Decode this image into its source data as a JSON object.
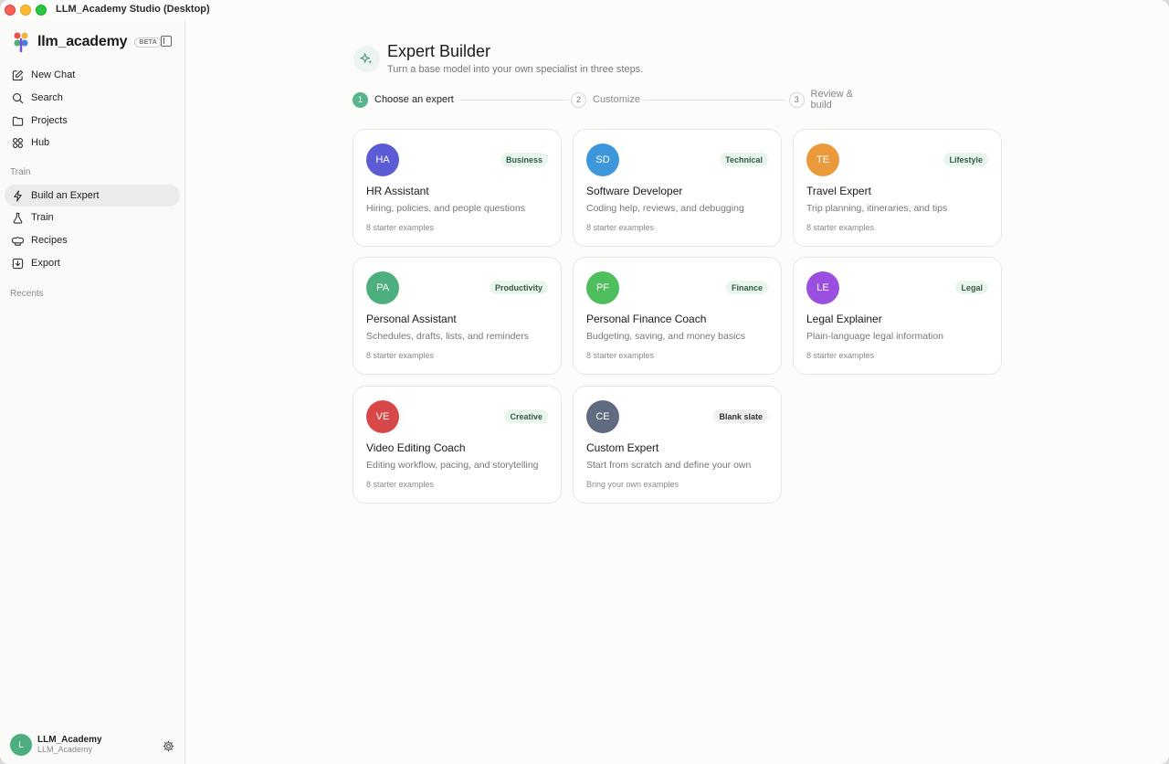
{
  "window": {
    "title": "LLM_Academy Studio (Desktop)"
  },
  "sidebar": {
    "brand": "llm_academy",
    "badge": "BETA",
    "nav": [
      {
        "label": "New Chat",
        "icon": "edit-icon"
      },
      {
        "label": "Search",
        "icon": "search-icon"
      },
      {
        "label": "Projects",
        "icon": "folder-icon"
      },
      {
        "label": "Hub",
        "icon": "grid-icon"
      }
    ],
    "train_section": "Train",
    "train_nav": [
      {
        "label": "Build an Expert",
        "icon": "sparkle-icon",
        "active": true
      },
      {
        "label": "Train",
        "icon": "flask-icon"
      },
      {
        "label": "Recipes",
        "icon": "chef-hat-icon"
      },
      {
        "label": "Export",
        "icon": "download-icon"
      }
    ],
    "recents_section": "Recents",
    "user": {
      "initial": "L",
      "name": "LLM_Academy",
      "handle": "LLM_Academy"
    }
  },
  "main": {
    "title": "Expert Builder",
    "subtitle": "Turn a base model into your own specialist in three steps.",
    "steps": [
      {
        "num": "1",
        "label": "Choose an expert",
        "active": true
      },
      {
        "num": "2",
        "label": "Customize",
        "active": false
      },
      {
        "num": "3",
        "label": "Review & build",
        "active": false
      }
    ],
    "cards": [
      {
        "initials": "HA",
        "color": "#5b5bd6",
        "tag": "Business",
        "title": "HR Assistant",
        "desc": "Hiring, policies, and people questions",
        "meta": "8 starter examples"
      },
      {
        "initials": "SD",
        "color": "#3e97da",
        "tag": "Technical",
        "title": "Software Developer",
        "desc": "Coding help, reviews, and debugging",
        "meta": "8 starter examples"
      },
      {
        "initials": "TE",
        "color": "#ea9a3a",
        "tag": "Lifestyle",
        "title": "Travel Expert",
        "desc": "Trip planning, itineraries, and tips",
        "meta": "8 starter examples"
      },
      {
        "initials": "PA",
        "color": "#4caf7d",
        "tag": "Productivity",
        "title": "Personal Assistant",
        "desc": "Schedules, drafts, lists, and reminders",
        "meta": "8 starter examples"
      },
      {
        "initials": "PF",
        "color": "#4fbf5e",
        "tag": "Finance",
        "title": "Personal Finance Coach",
        "desc": "Budgeting, saving, and money basics",
        "meta": "8 starter examples"
      },
      {
        "initials": "LE",
        "color": "#9b4fe0",
        "tag": "Legal",
        "title": "Legal Explainer",
        "desc": "Plain-language legal information",
        "meta": "8 starter examples"
      },
      {
        "initials": "VE",
        "color": "#d94848",
        "tag": "Creative",
        "title": "Video Editing Coach",
        "desc": "Editing workflow, pacing, and storytelling",
        "meta": "8 starter examples"
      },
      {
        "initials": "CE",
        "color": "#5f6b80",
        "tag": "Blank slate",
        "title": "Custom Expert",
        "desc": "Start from scratch and define your own",
        "meta": "Bring your own examples",
        "neutral": true
      }
    ]
  }
}
